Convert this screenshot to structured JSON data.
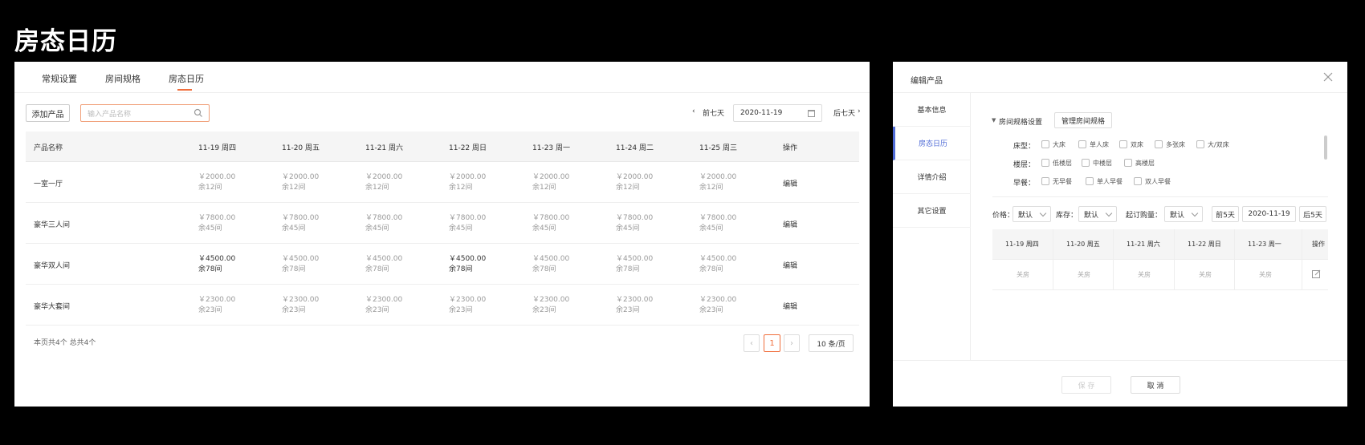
{
  "page_title": "房态日历",
  "tabs": [
    "常规设置",
    "房间规格",
    "房态日历"
  ],
  "toolbar": {
    "add_product": "添加产品",
    "search_placeholder": "输入产品名称",
    "prev_week": "前七天",
    "date": "2020-11-19",
    "next_week": "后七天"
  },
  "table": {
    "headers": [
      "产品名称",
      "11-19 周四",
      "11-20 周五",
      "11-21 周六",
      "11-22 周日",
      "11-23 周一",
      "11-24 周二",
      "11-25 周三",
      "操作"
    ],
    "rows": [
      {
        "name": "一室一厅",
        "price": "￥2000.00",
        "stock": "余12间",
        "op": "编辑"
      },
      {
        "name": "豪华三人间",
        "price": "￥7800.00",
        "stock": "余45间",
        "op": "编辑"
      },
      {
        "name": "豪华双人间",
        "price": "￥4500.00",
        "stock": "余78间",
        "op": "编辑"
      },
      {
        "name": "豪华大套间",
        "price": "￥2300.00",
        "stock": "余23间",
        "op": "编辑"
      }
    ]
  },
  "footer": {
    "summary": "本页共4个 总共4个",
    "page": "1",
    "page_size": "10 条/页"
  },
  "dialog": {
    "title": "编辑产品",
    "side": [
      "基本信息",
      "房态日历",
      "详情介绍",
      "其它设置"
    ],
    "spec_toggle": "房间规格设置",
    "manage_btn": "管理房间规格",
    "bed_label": "床型：",
    "bed_options": [
      "大床",
      "单人床",
      "双床",
      "多张床",
      "大/双床"
    ],
    "floor_label": "楼层：",
    "floor_options": [
      "低楼层",
      "中楼层",
      "高楼层"
    ],
    "breakfast_label": "早餐：",
    "breakfast_options": [
      "无早餐",
      "单人早餐",
      "双人早餐"
    ],
    "price_label": "价格：",
    "price_sel": "默认",
    "stock_label": "库存：",
    "stock_sel": "默认",
    "min_label": "起订购量：",
    "min_sel": "默认",
    "prev5": "前5天",
    "date": "2020-11-19",
    "next5": "后5天",
    "mini_headers": [
      "11-19 周四",
      "11-20 周五",
      "11-21 周六",
      "11-22 周日",
      "11-23 周一",
      "操作"
    ],
    "mini_cells": [
      "关房",
      "关房",
      "关房",
      "关房",
      "关房"
    ],
    "save": "保 存",
    "cancel": "取 消"
  }
}
